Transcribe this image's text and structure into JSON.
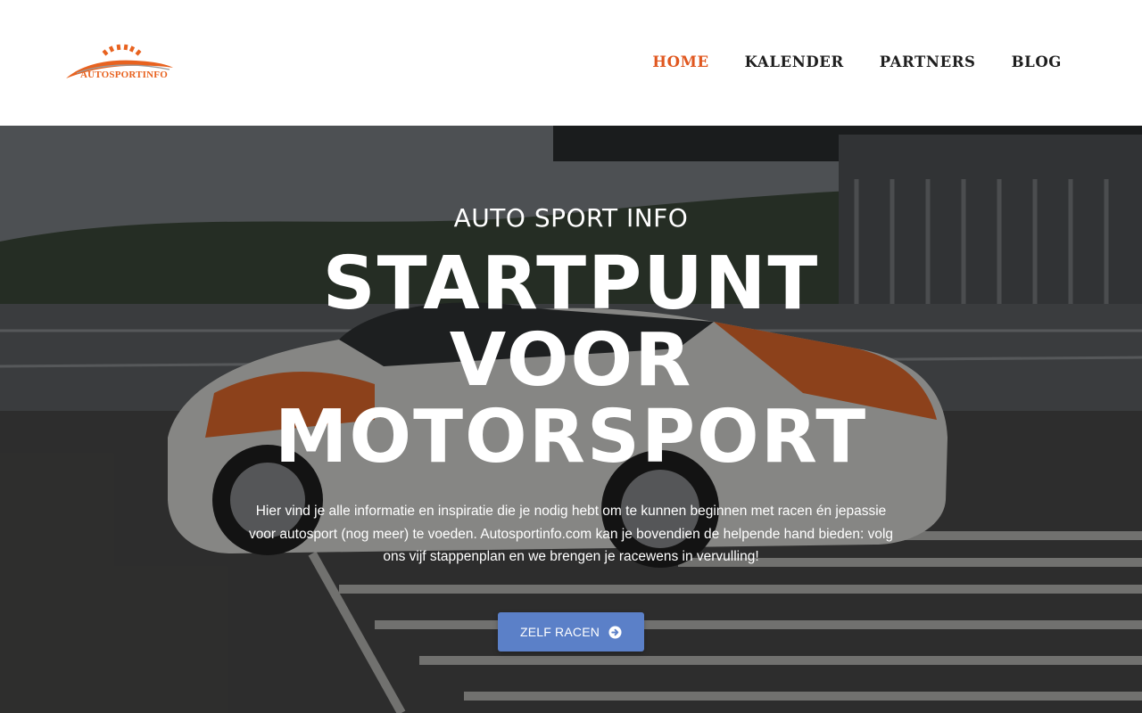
{
  "header": {
    "logo_text": "AUTOSPORTINFO",
    "nav": [
      {
        "label": "HOME",
        "active": true
      },
      {
        "label": "KALENDER",
        "active": false
      },
      {
        "label": "PARTNERS",
        "active": false
      },
      {
        "label": "BLOG",
        "active": false
      }
    ]
  },
  "hero": {
    "kicker": "AUTO SPORT INFO",
    "title_lines": [
      "STARTPUNT",
      "VOOR",
      "MOTORSPORT"
    ],
    "text": "Hier vind je alle informatie en inspiratie die je nodig hebt om te kunnen beginnen met racen én jepassie voor autosport (nog meer) te voeden. Autosportinfo.com kan je bovendien de helpende hand bieden: volg ons vijf stappenplan en we brengen je racewens in vervulling!",
    "cta_label": "ZELF RACEN",
    "cta_icon": "arrow-circle-right-icon"
  },
  "colors": {
    "accent": "#e0571f",
    "button": "#5b80c8",
    "nav_text": "#1e1e1e"
  }
}
